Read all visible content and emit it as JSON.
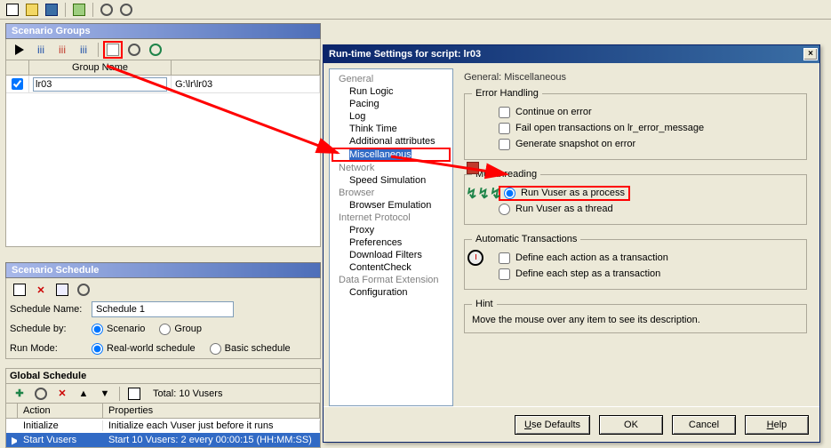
{
  "main_toolbar": {
    "icons": [
      "new-icon",
      "open-icon",
      "save-icon",
      "grid-icon",
      "gear1-icon",
      "gear2-icon"
    ]
  },
  "scenario_groups": {
    "title": "Scenario Groups",
    "columns": {
      "chk": "",
      "name": "Group Name",
      "path": ""
    },
    "row": {
      "checked": true,
      "name": "lr03",
      "path": "G:\\lr\\lr03"
    }
  },
  "scenario_schedule": {
    "title": "Scenario Schedule",
    "schedule_name_label": "Schedule Name:",
    "schedule_name_value": "Schedule 1",
    "schedule_by_label": "Schedule by:",
    "schedule_by_scenario": "Scenario",
    "schedule_by_group": "Group",
    "run_mode_label": "Run Mode:",
    "run_mode_real": "Real-world schedule",
    "run_mode_basic": "Basic schedule"
  },
  "global_schedule": {
    "title": "Global Schedule",
    "total": "Total: 10 Vusers",
    "columns": {
      "action": "Action",
      "properties": "Properties"
    },
    "rows": [
      {
        "action": "Initialize",
        "properties": "Initialize each Vuser just before it runs",
        "selected": false
      },
      {
        "action": "Start Vusers",
        "properties": "Start 10 Vusers: 2 every 00:00:15 (HH:MM:SS)",
        "selected": true
      }
    ]
  },
  "dialog": {
    "title": "Run-time Settings for script: lr03",
    "tree": {
      "general": "General",
      "items_general": [
        "Run Logic",
        "Pacing",
        "Log",
        "Think Time",
        "Additional attributes",
        "Miscellaneous"
      ],
      "network": "Network",
      "items_network": [
        "Speed Simulation"
      ],
      "browser": "Browser",
      "items_browser": [
        "Browser Emulation"
      ],
      "internet": "Internet Protocol",
      "items_internet": [
        "Proxy",
        "Preferences",
        "Download Filters",
        "ContentCheck"
      ],
      "dfe": "Data Format Extension",
      "items_dfe": [
        "Configuration"
      ]
    },
    "heading": "General: Miscellaneous",
    "error_handling": {
      "legend": "Error Handling",
      "continue": "Continue on error",
      "fail_open": "Fail open transactions on lr_error_message",
      "snapshot": "Generate snapshot on error"
    },
    "multithreading": {
      "legend": "Multithreading",
      "process": "Run Vuser as a process",
      "thread": "Run Vuser as a thread"
    },
    "auto_trans": {
      "legend": "Automatic Transactions",
      "each_action": "Define each action as a transaction",
      "each_step": "Define each step as a transaction"
    },
    "hint": {
      "legend": "Hint",
      "text": "Move the mouse over any item to see its description."
    },
    "buttons": {
      "defaults": "Use Defaults",
      "ok": "OK",
      "cancel": "Cancel",
      "help": "Help"
    }
  }
}
